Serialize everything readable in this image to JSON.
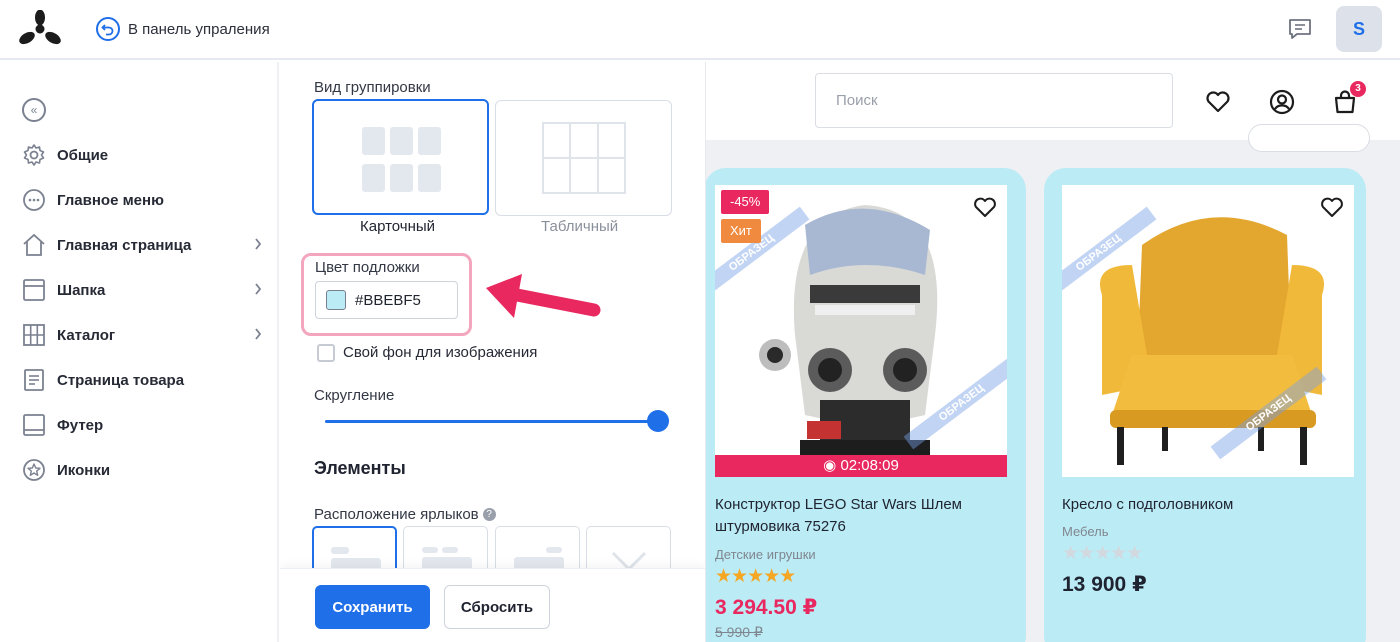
{
  "topbar": {
    "back_label": "В панель упраления",
    "avatar_letter": "S"
  },
  "sidebar": {
    "items": [
      {
        "label": "Общие",
        "icon": "gear-icon",
        "has_submenu": false
      },
      {
        "label": "Главное меню",
        "icon": "dots-circle-icon",
        "has_submenu": false
      },
      {
        "label": "Главная страница",
        "icon": "home-icon",
        "has_submenu": true
      },
      {
        "label": "Шапка",
        "icon": "header-layout-icon",
        "has_submenu": true
      },
      {
        "label": "Каталог",
        "icon": "grid-icon",
        "has_submenu": true
      },
      {
        "label": "Страница товара",
        "icon": "document-icon",
        "has_submenu": false
      },
      {
        "label": "Футер",
        "icon": "footer-layout-icon",
        "has_submenu": false
      },
      {
        "label": "Иконки",
        "icon": "star-circle-icon",
        "has_submenu": false
      }
    ]
  },
  "settings": {
    "grouping_label": "Вид группировки",
    "grouping_options": [
      {
        "label": "Карточный",
        "selected": true
      },
      {
        "label": "Табличный",
        "selected": false
      }
    ],
    "bg_color_label": "Цвет подложки",
    "bg_color_value": "#BBEBF5",
    "custom_bg_label": "Свой фон для изображения",
    "custom_bg_checked": false,
    "rounding_label": "Скругление",
    "rounding_value": 1.0,
    "elements_title": "Элементы",
    "labels_position_label": "Расположение ярлыков",
    "save_label": "Сохранить",
    "reset_label": "Сбросить"
  },
  "preview": {
    "search_placeholder": "Поиск",
    "cart_count": "3",
    "card_bg": "#BBEBF5",
    "products": [
      {
        "title": "Конструктор LEGO Star Wars Шлем штурмовика 75276",
        "category": "Детские игрушки",
        "price": "3 294.50 ₽",
        "old_price": "5 990 ₽",
        "rating": 5,
        "badges": [
          "-45%",
          "Хит"
        ],
        "timer": "02:08:09"
      },
      {
        "title": "Кресло с подголовником",
        "category": "Мебель",
        "price": "13 900 ₽",
        "rating": 0
      }
    ],
    "watermark": "ОБРАЗЕЦ"
  },
  "colors": {
    "accent": "#1E6FE8",
    "sale": "#E8285F",
    "hit": "#F08A3E",
    "highlight": "#F3A6BE"
  }
}
